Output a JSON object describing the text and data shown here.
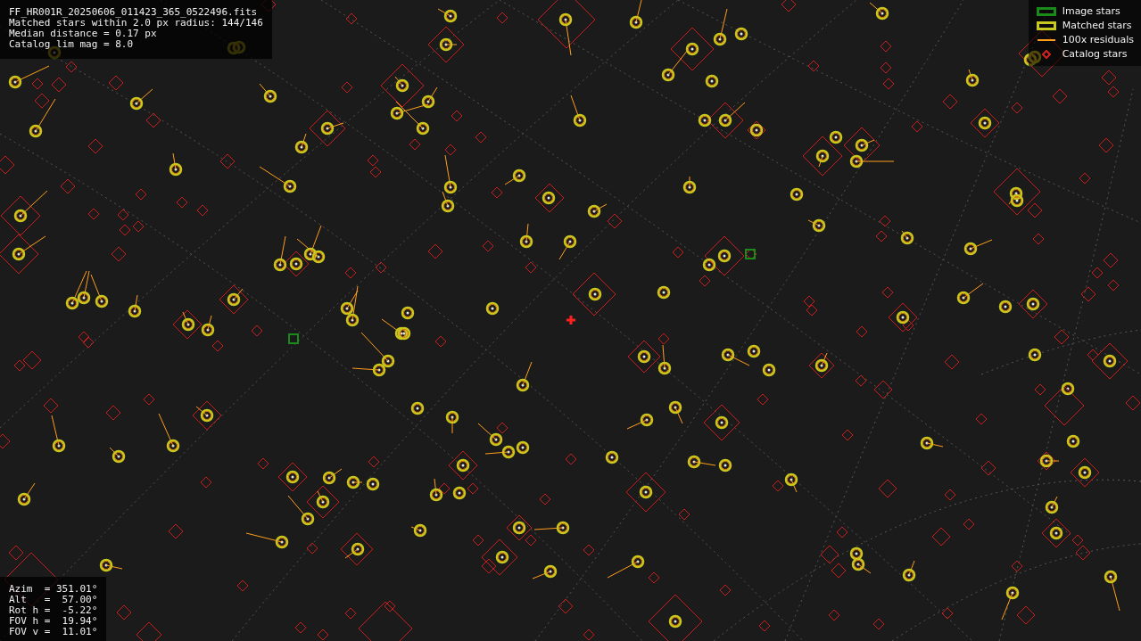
{
  "file_info": [
    "FF_HR001R_20250606_011423_365_0522496.fits",
    "Matched stars within 2.0 px radius: 144/146",
    "Median distance = 0.17 px",
    "Catalog lim mag = 8.0"
  ],
  "legend": [
    {
      "kind": "box",
      "label": "Image stars",
      "color": "#1a8a1a"
    },
    {
      "kind": "box",
      "label": "Matched stars",
      "color": "#c8c81e"
    },
    {
      "kind": "line",
      "label": "100x residuals",
      "color": "#ff9f1c"
    },
    {
      "kind": "diamond",
      "label": "Catalog stars",
      "color": "#c81e1e"
    }
  ],
  "pointing": [
    "Azim  = 351.01°",
    "Alt   =  57.00°",
    "Rot h =  -5.22°",
    "FOV h =  19.94°",
    "FOV v =  11.01°"
  ]
}
